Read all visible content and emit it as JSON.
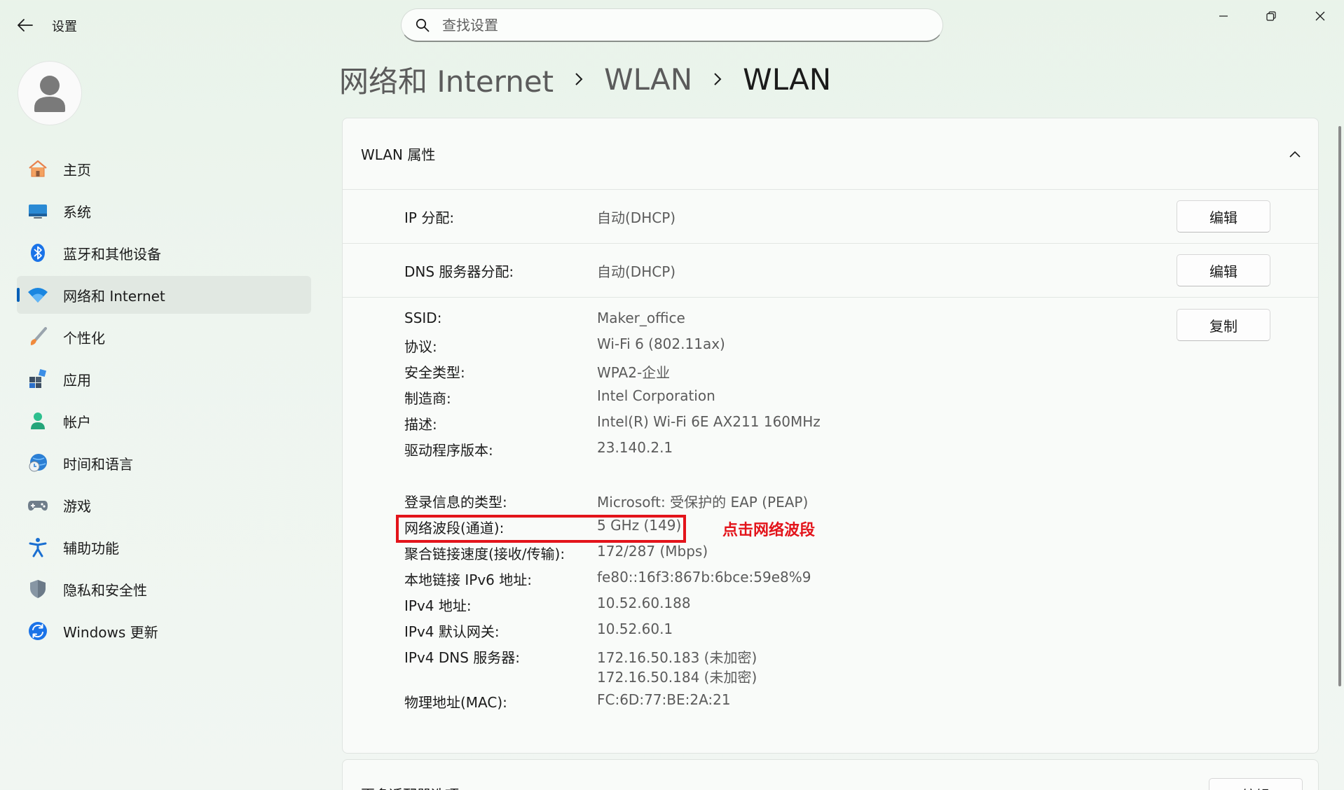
{
  "window": {
    "title": "设置",
    "controls": {
      "minimize": "minimize-icon",
      "restore": "restore-icon",
      "close": "close-icon"
    }
  },
  "search": {
    "placeholder": "查找设置",
    "value": ""
  },
  "sidebar": {
    "items": [
      {
        "label": "主页",
        "icon": "home-icon"
      },
      {
        "label": "系统",
        "icon": "system-display-icon"
      },
      {
        "label": "蓝牙和其他设备",
        "icon": "bluetooth-icon"
      },
      {
        "label": "网络和 Internet",
        "icon": "wifi-icon",
        "active": true
      },
      {
        "label": "个性化",
        "icon": "brush-icon"
      },
      {
        "label": "应用",
        "icon": "apps-icon"
      },
      {
        "label": "帐户",
        "icon": "account-icon"
      },
      {
        "label": "时间和语言",
        "icon": "time-language-icon"
      },
      {
        "label": "游戏",
        "icon": "gamepad-icon"
      },
      {
        "label": "辅助功能",
        "icon": "accessibility-icon"
      },
      {
        "label": "隐私和安全性",
        "icon": "shield-icon"
      },
      {
        "label": "Windows 更新",
        "icon": "windows-update-icon"
      }
    ]
  },
  "breadcrumb": [
    "网络和 Internet",
    "WLAN",
    "WLAN"
  ],
  "card": {
    "title": "WLAN 属性",
    "ip": {
      "label": "IP 分配:",
      "value": "自动(DHCP)",
      "button": "编辑"
    },
    "dns": {
      "label": "DNS 服务器分配:",
      "value": "自动(DHCP)",
      "button": "编辑"
    },
    "copy_button": "复制",
    "props": [
      {
        "k": "SSID:",
        "v": "Maker_office"
      },
      {
        "k": "协议:",
        "v": "Wi-Fi 6 (802.11ax)"
      },
      {
        "k": "安全类型:",
        "v": "WPA2-企业"
      },
      {
        "k": "制造商:",
        "v": "Intel Corporation"
      },
      {
        "k": "描述:",
        "v": "Intel(R) Wi-Fi 6E AX211 160MHz"
      },
      {
        "k": "驱动程序版本:",
        "v": "23.140.2.1"
      },
      {
        "k": "登录信息的类型:",
        "v": "Microsoft: 受保护的 EAP (PEAP)"
      },
      {
        "k": "网络波段(通道):",
        "v": "5 GHz (149)"
      },
      {
        "k": "聚合链接速度(接收/传输):",
        "v": "172/287 (Mbps)"
      },
      {
        "k": "本地链接 IPv6 地址:",
        "v": "fe80::16f3:867b:6bce:59e8%9"
      },
      {
        "k": "IPv4 地址:",
        "v": "10.52.60.188"
      },
      {
        "k": "IPv4 默认网关:",
        "v": "10.52.60.1"
      },
      {
        "k": "IPv4 DNS 服务器:",
        "v": "172.16.50.183 (未加密)",
        "v2": "172.16.50.184 (未加密)"
      },
      {
        "k": "物理地址(MAC):",
        "v": "FC:6D:77:BE:2A:21"
      }
    ]
  },
  "annotation": {
    "text": "点击网络波段",
    "color": "#e3141b"
  },
  "card2": {
    "title": "更多适配器选项",
    "button": "编辑"
  },
  "colors": {
    "accent": "#005fb8",
    "highlight": "#e3141b"
  }
}
